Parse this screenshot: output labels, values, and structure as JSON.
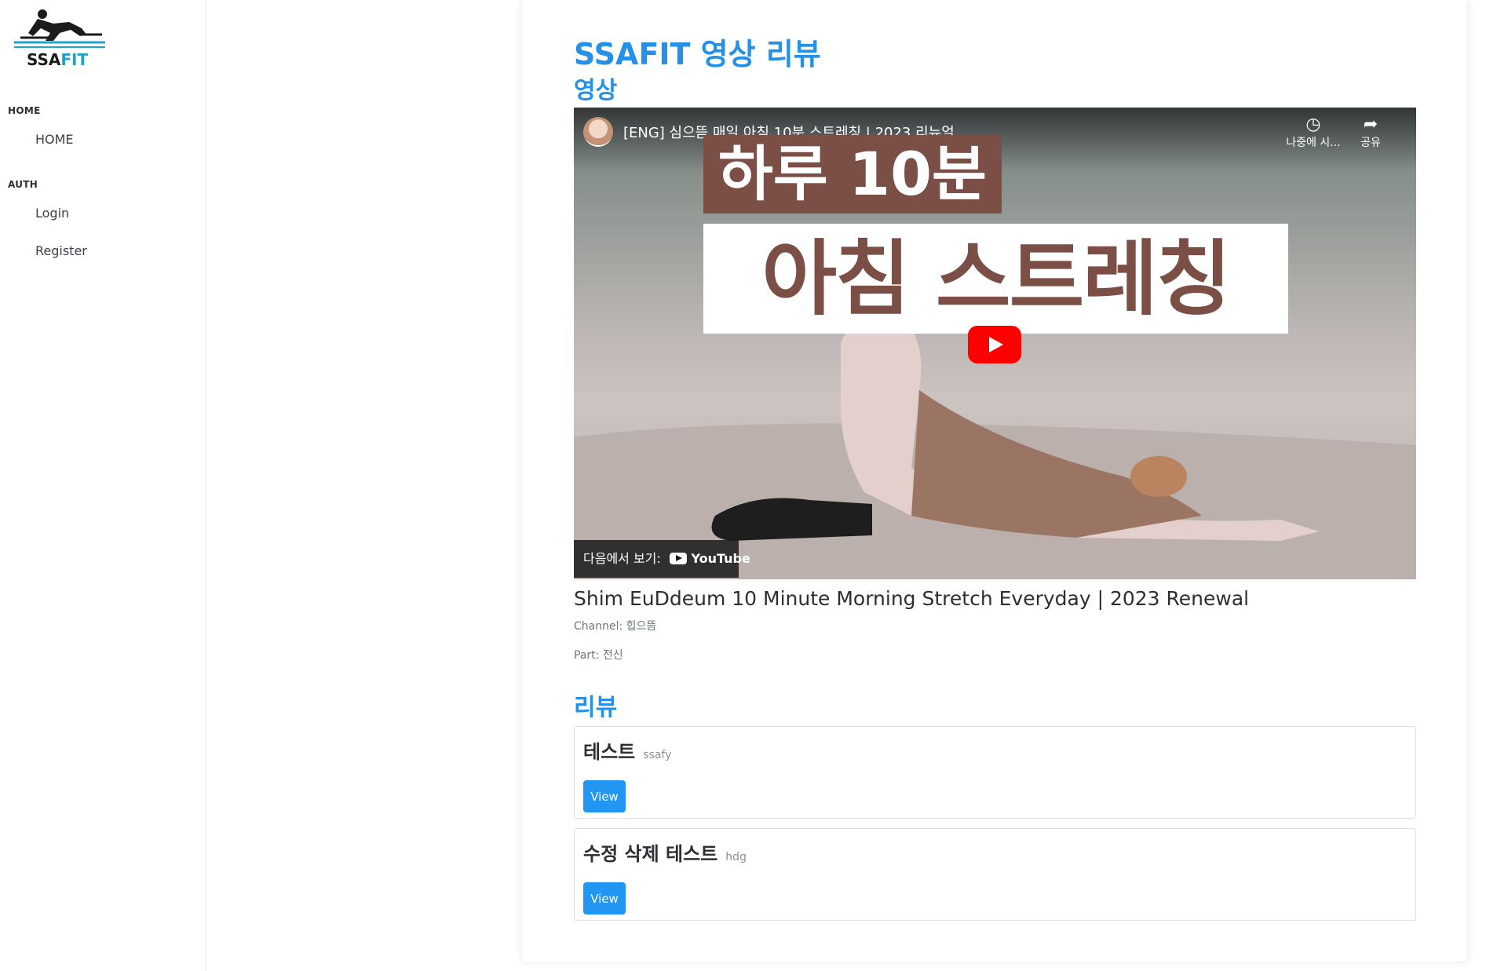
{
  "brand": {
    "logo_text": "SSAFIT",
    "logo_text_dark": "SSA",
    "logo_text_accent": "FIT",
    "accent": "#21a3c4"
  },
  "sidebar": {
    "sections": [
      {
        "heading": "HOME",
        "items": [
          {
            "label": "HOME"
          }
        ]
      },
      {
        "heading": "AUTH",
        "items": [
          {
            "label": "Login"
          },
          {
            "label": "Register"
          }
        ]
      }
    ]
  },
  "page": {
    "title": "SSAFIT 영상 리뷰",
    "video_heading": "영상",
    "review_heading": "리뷰"
  },
  "video": {
    "embed_title": "[ENG] 심으뜸 매일 아침 10분 스트레칭 | 2023 리뉴얼",
    "thumb_line1": "하루 10분",
    "thumb_line2": "아침 스트레칭",
    "watch_later": "나중에 시...",
    "share": "공유",
    "watch_on": "다음에서 보기:",
    "youtube": "YouTube",
    "name": "Shim EuDdeum 10 Minute Morning Stretch Everyday | 2023 Renewal",
    "channel_label": "Channel:",
    "channel": "힙으뜸",
    "part_label": "Part:",
    "part": "전신"
  },
  "reviews": [
    {
      "title": "테스트",
      "user": "ssafy",
      "button": "View"
    },
    {
      "title": "수정 삭제 테스트",
      "user": "hdg",
      "button": "View"
    }
  ],
  "colors": {
    "primary": "#2490e6",
    "button": "#2196f3",
    "thumb_brown": "#7b4f46"
  }
}
